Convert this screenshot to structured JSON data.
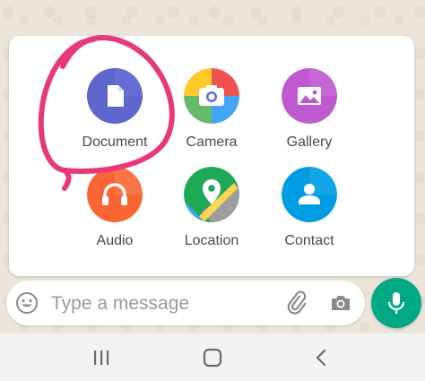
{
  "attach_menu": {
    "items": [
      {
        "label": "Document",
        "icon": "document-icon",
        "color": "#5f66cd"
      },
      {
        "label": "Camera",
        "icon": "camera-icon",
        "color": "multicolor"
      },
      {
        "label": "Gallery",
        "icon": "gallery-icon",
        "color": "#bf59cf"
      },
      {
        "label": "Audio",
        "icon": "headphones-icon",
        "color": "#f96533"
      },
      {
        "label": "Location",
        "icon": "map-pin-icon",
        "color": "#1fa855"
      },
      {
        "label": "Contact",
        "icon": "person-icon",
        "color": "#009de2"
      }
    ]
  },
  "composer": {
    "placeholder": "Type a message",
    "emoji_icon": "emoji-icon",
    "attach_icon": "paperclip-icon",
    "camera_icon": "camera-icon"
  },
  "mic_button": {
    "icon": "mic-icon",
    "color": "#00a884"
  },
  "annotation": {
    "color": "#e8387a",
    "target": "Document"
  },
  "nav_bar": {
    "icons": [
      "recent-apps-icon",
      "home-icon",
      "back-icon"
    ]
  }
}
